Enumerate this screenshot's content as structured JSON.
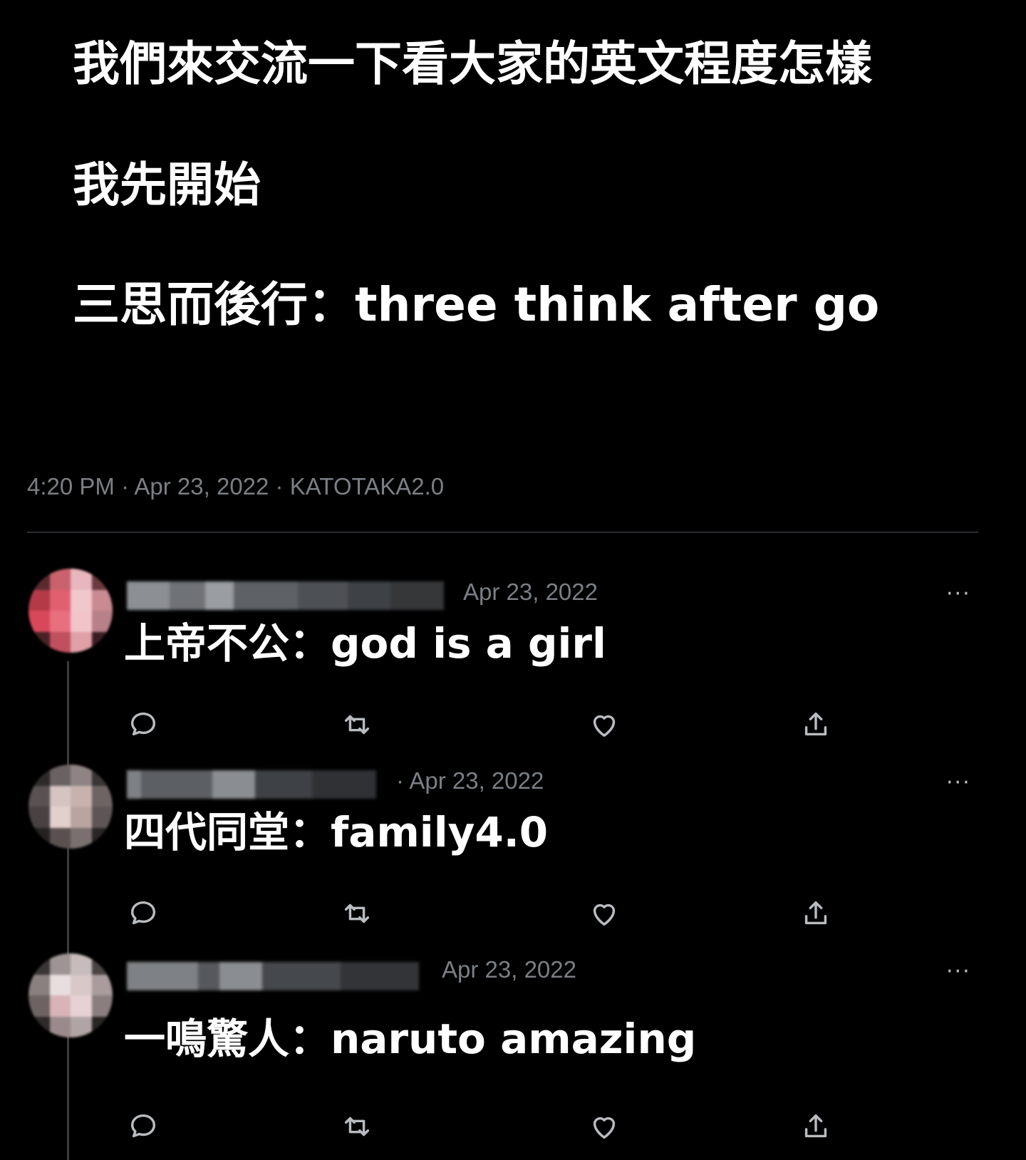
{
  "post": {
    "lines": [
      "我們來交流一下看大家的英文程度怎樣",
      "我先開始",
      "三思而後行：three think after go"
    ],
    "meta": "4:20 PM · Apr 23, 2022 · KATOTAKA2.0"
  },
  "replies": [
    {
      "date": "Apr 23, 2022",
      "text": "上帝不公：god is a girl",
      "more": "···"
    },
    {
      "date": "· Apr 23, 2022",
      "text": "四代同堂：family4.0",
      "more": "···"
    },
    {
      "date": "Apr 23, 2022",
      "text": "一鳴驚人：naruto amazing",
      "more": "···"
    }
  ],
  "icons": {
    "reply": "reply-icon",
    "retweet": "retweet-icon",
    "like": "heart-icon",
    "share": "share-icon"
  },
  "colors": {
    "background": "#000000",
    "text": "#ffffff",
    "muted": "#7b7f84",
    "icon": "#b9bcc0"
  }
}
